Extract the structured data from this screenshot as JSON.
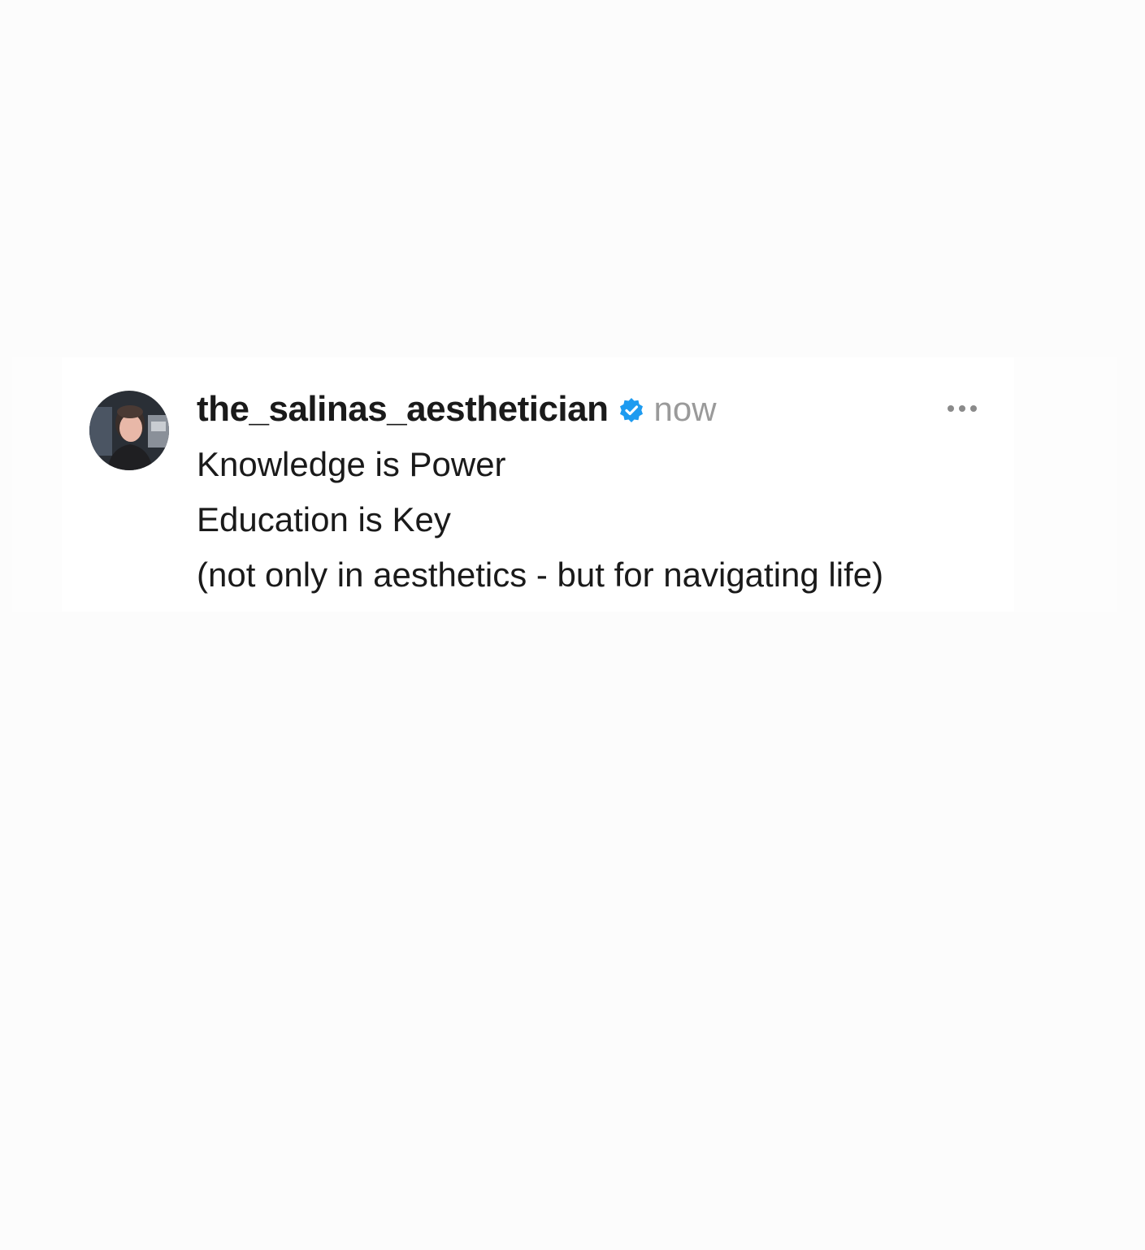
{
  "post": {
    "username": "the_salinas_aesthetician",
    "verified": true,
    "timestamp": "now",
    "lines": [
      "Knowledge is Power",
      "Education is Key",
      "(not only in aesthetics - but for navigating life)"
    ]
  },
  "icons": {
    "verified": "verified-badge-icon",
    "more": "more-options-icon",
    "avatar": "profile-photo"
  },
  "colors": {
    "verified": "#1d9bf0",
    "username": "#1a1a1a",
    "timestamp": "#9a9a9a",
    "background": "#fcfcfc"
  }
}
